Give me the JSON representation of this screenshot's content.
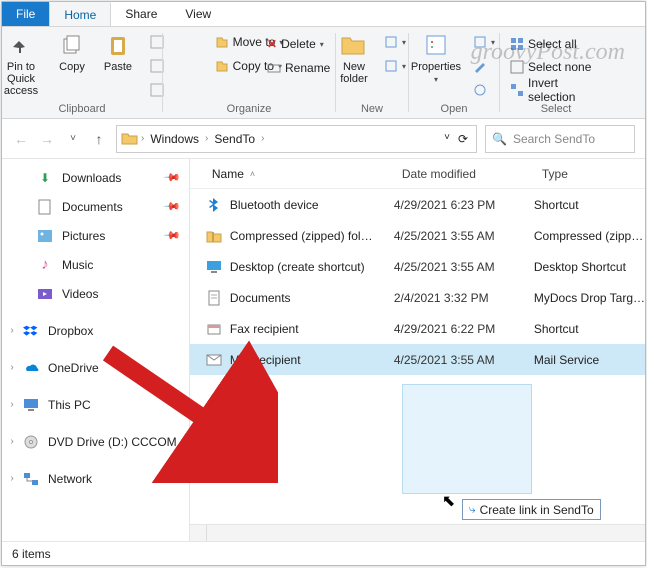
{
  "watermark": "groovyPost.com",
  "menu": {
    "file": "File",
    "home": "Home",
    "share": "Share",
    "view": "View"
  },
  "ribbon": {
    "clipboard": {
      "pin": "Pin to Quick\naccess",
      "copy": "Copy",
      "paste": "Paste",
      "label": "Clipboard"
    },
    "organize": {
      "move": "Move to",
      "copy": "Copy to",
      "delete": "Delete",
      "rename": "Rename",
      "label": "Organize"
    },
    "new": {
      "folder": "New\nfolder",
      "label": "New"
    },
    "open": {
      "properties": "Properties",
      "label": "Open"
    },
    "select": {
      "all": "Select all",
      "none": "Select none",
      "invert": "Invert selection",
      "label": "Select"
    }
  },
  "nav": {
    "crumbs": [
      "Windows",
      "SendTo"
    ],
    "search_placeholder": "Search SendTo"
  },
  "sidebar": {
    "items": [
      {
        "label": "Downloads",
        "pinned": true
      },
      {
        "label": "Documents",
        "pinned": true
      },
      {
        "label": "Pictures",
        "pinned": true
      },
      {
        "label": "Music"
      },
      {
        "label": "Videos"
      }
    ],
    "roots": [
      {
        "label": "Dropbox"
      },
      {
        "label": "OneDrive"
      },
      {
        "label": "This PC"
      },
      {
        "label": "DVD Drive (D:) CCCOM"
      },
      {
        "label": "Network"
      }
    ]
  },
  "columns": {
    "name": "Name",
    "date": "Date modified",
    "type": "Type"
  },
  "rows": [
    {
      "name": "Bluetooth device",
      "date": "4/29/2021 6:23 PM",
      "type": "Shortcut"
    },
    {
      "name": "Compressed (zipped) fol…",
      "date": "4/25/2021 3:55 AM",
      "type": "Compressed (zipp…"
    },
    {
      "name": "Desktop (create shortcut)",
      "date": "4/25/2021 3:55 AM",
      "type": "Desktop Shortcut"
    },
    {
      "name": "Documents",
      "date": "2/4/2021 3:32 PM",
      "type": "MyDocs Drop Targ…"
    },
    {
      "name": "Fax recipient",
      "date": "4/29/2021 6:22 PM",
      "type": "Shortcut"
    },
    {
      "name": "Mail recipient",
      "date": "4/25/2021 3:55 AM",
      "type": "Mail Service"
    }
  ],
  "drop_hint": "Create link in SendTo",
  "status": "6 items"
}
